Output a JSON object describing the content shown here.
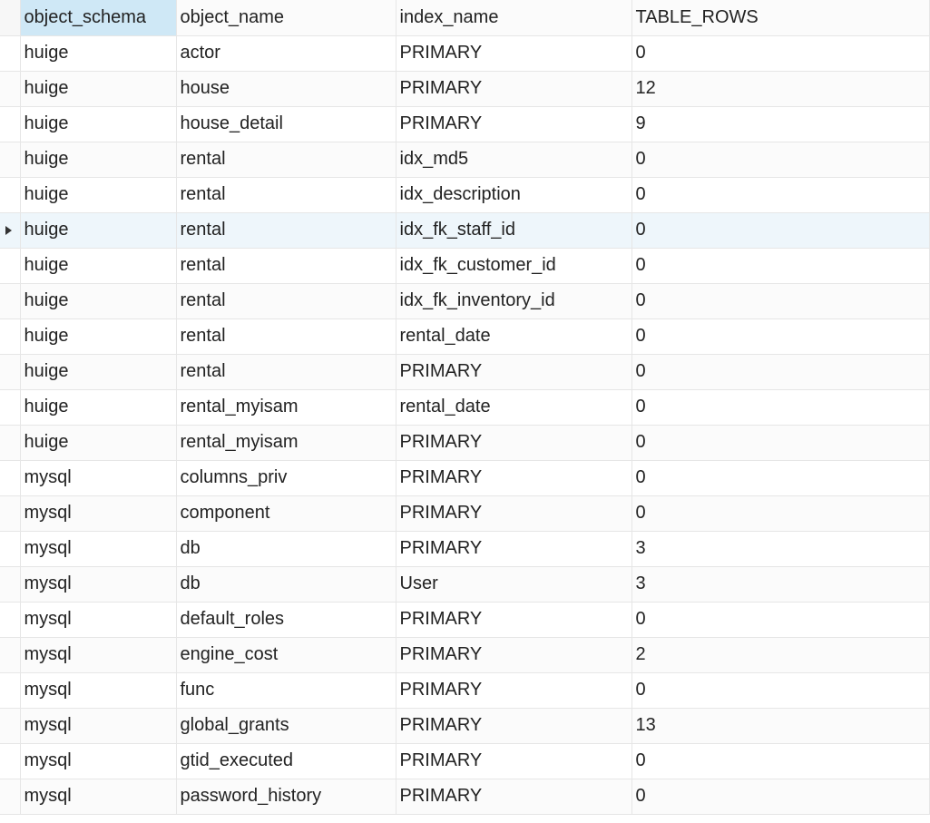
{
  "columns": [
    {
      "key": "object_schema",
      "label": "object_schema"
    },
    {
      "key": "object_name",
      "label": "object_name"
    },
    {
      "key": "index_name",
      "label": "index_name"
    },
    {
      "key": "table_rows",
      "label": "TABLE_ROWS"
    }
  ],
  "selected_header_index": 0,
  "selected_row_index": 5,
  "rows": [
    {
      "object_schema": "huige",
      "object_name": "actor",
      "index_name": "PRIMARY",
      "table_rows": "0"
    },
    {
      "object_schema": "huige",
      "object_name": "house",
      "index_name": "PRIMARY",
      "table_rows": "12"
    },
    {
      "object_schema": "huige",
      "object_name": "house_detail",
      "index_name": "PRIMARY",
      "table_rows": "9"
    },
    {
      "object_schema": "huige",
      "object_name": "rental",
      "index_name": "idx_md5",
      "table_rows": "0"
    },
    {
      "object_schema": "huige",
      "object_name": "rental",
      "index_name": "idx_description",
      "table_rows": "0"
    },
    {
      "object_schema": "huige",
      "object_name": "rental",
      "index_name": "idx_fk_staff_id",
      "table_rows": "0"
    },
    {
      "object_schema": "huige",
      "object_name": "rental",
      "index_name": "idx_fk_customer_id",
      "table_rows": "0"
    },
    {
      "object_schema": "huige",
      "object_name": "rental",
      "index_name": "idx_fk_inventory_id",
      "table_rows": "0"
    },
    {
      "object_schema": "huige",
      "object_name": "rental",
      "index_name": "rental_date",
      "table_rows": "0"
    },
    {
      "object_schema": "huige",
      "object_name": "rental",
      "index_name": "PRIMARY",
      "table_rows": "0"
    },
    {
      "object_schema": "huige",
      "object_name": "rental_myisam",
      "index_name": "rental_date",
      "table_rows": "0"
    },
    {
      "object_schema": "huige",
      "object_name": "rental_myisam",
      "index_name": "PRIMARY",
      "table_rows": "0"
    },
    {
      "object_schema": "mysql",
      "object_name": "columns_priv",
      "index_name": "PRIMARY",
      "table_rows": "0"
    },
    {
      "object_schema": "mysql",
      "object_name": "component",
      "index_name": "PRIMARY",
      "table_rows": "0"
    },
    {
      "object_schema": "mysql",
      "object_name": "db",
      "index_name": "PRIMARY",
      "table_rows": "3"
    },
    {
      "object_schema": "mysql",
      "object_name": "db",
      "index_name": "User",
      "table_rows": "3"
    },
    {
      "object_schema": "mysql",
      "object_name": "default_roles",
      "index_name": "PRIMARY",
      "table_rows": "0"
    },
    {
      "object_schema": "mysql",
      "object_name": "engine_cost",
      "index_name": "PRIMARY",
      "table_rows": "2"
    },
    {
      "object_schema": "mysql",
      "object_name": "func",
      "index_name": "PRIMARY",
      "table_rows": "0"
    },
    {
      "object_schema": "mysql",
      "object_name": "global_grants",
      "index_name": "PRIMARY",
      "table_rows": "13"
    },
    {
      "object_schema": "mysql",
      "object_name": "gtid_executed",
      "index_name": "PRIMARY",
      "table_rows": "0"
    },
    {
      "object_schema": "mysql",
      "object_name": "password_history",
      "index_name": "PRIMARY",
      "table_rows": "0"
    }
  ]
}
